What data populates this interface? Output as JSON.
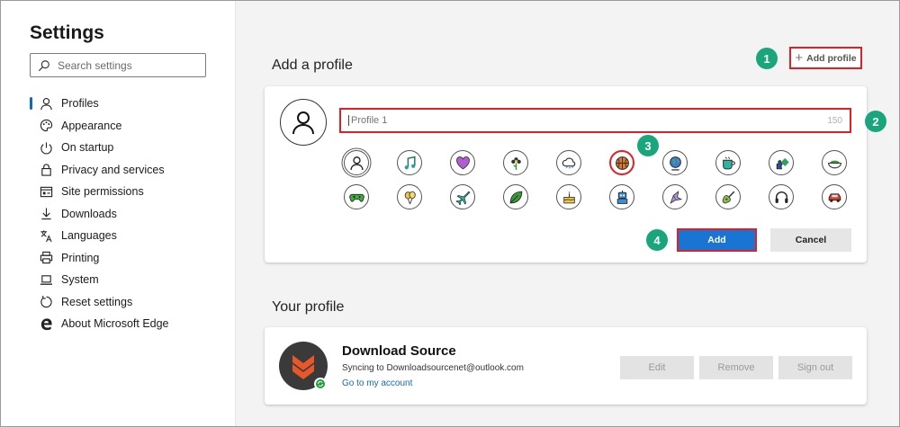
{
  "sidebar": {
    "title": "Settings",
    "search_placeholder": "Search settings",
    "items": [
      {
        "label": "Profiles",
        "icon": "person-icon"
      },
      {
        "label": "Appearance",
        "icon": "palette-icon"
      },
      {
        "label": "On startup",
        "icon": "power-icon"
      },
      {
        "label": "Privacy and services",
        "icon": "lock-icon"
      },
      {
        "label": "Site permissions",
        "icon": "site-permissions-icon"
      },
      {
        "label": "Downloads",
        "icon": "download-icon"
      },
      {
        "label": "Languages",
        "icon": "languages-icon"
      },
      {
        "label": "Printing",
        "icon": "printer-icon"
      },
      {
        "label": "System",
        "icon": "laptop-icon"
      },
      {
        "label": "Reset settings",
        "icon": "reset-icon"
      },
      {
        "label": "About Microsoft Edge",
        "icon": "edge-logo-icon"
      }
    ],
    "active_index": 0
  },
  "add_profile": {
    "section_title": "Add a profile",
    "link_label": "Add profile",
    "name_placeholder": "Profile 1",
    "char_count": "150",
    "add_label": "Add",
    "cancel_label": "Cancel",
    "icons": [
      "person-avatar-icon",
      "music-note-icon",
      "heart-icon",
      "flower-icon",
      "cloud-icon",
      "ball-icon",
      "globe-icon",
      "coffee-cup-icon",
      "chess-icon",
      "bowl-icon",
      "gamepad-icon",
      "balloons-icon",
      "airplane-icon",
      "leaf-icon",
      "cake-icon",
      "robot-icon",
      "bird-icon",
      "guitar-icon",
      "headphones-icon",
      "car-icon"
    ],
    "selected_icon_index": 5
  },
  "steps": [
    "1",
    "2",
    "3",
    "4"
  ],
  "your_profile": {
    "section_title": "Your profile",
    "name": "Download Source",
    "sync_text": "Syncing to Downloadsourcenet@outlook.com",
    "account_link": "Go to my account",
    "edit_label": "Edit",
    "remove_label": "Remove",
    "signout_label": "Sign out"
  },
  "colors": {
    "accent": "#1a75d2",
    "highlight_box": "#e01f26",
    "step_badge": "#19a67d",
    "sync_green": "#1d9f3d",
    "avatar_orange": "#e8572a"
  }
}
